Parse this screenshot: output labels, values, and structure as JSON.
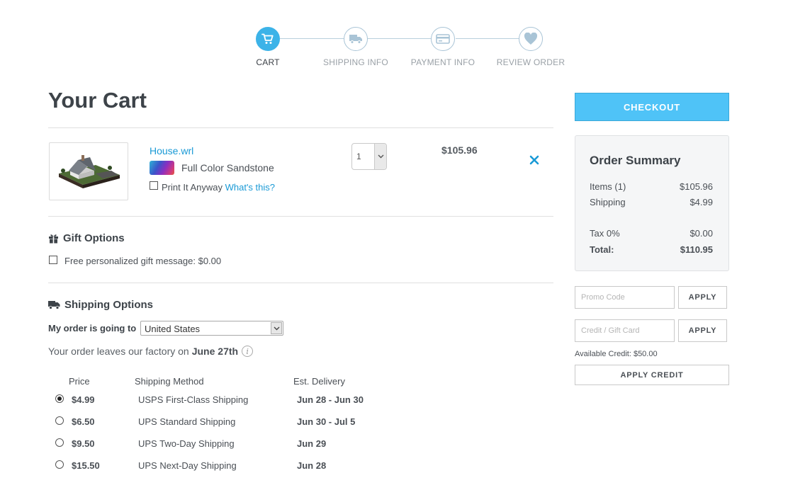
{
  "steps": [
    {
      "label": "CART",
      "icon": "cart-icon",
      "active": true
    },
    {
      "label": "SHIPPING INFO",
      "icon": "truck-icon",
      "active": false
    },
    {
      "label": "PAYMENT INFO",
      "icon": "credit-card-icon",
      "active": false
    },
    {
      "label": "REVIEW ORDER",
      "icon": "heart-icon",
      "active": false
    }
  ],
  "page": {
    "title": "Your Cart"
  },
  "cart_item": {
    "name": "House.wrl",
    "material": "Full Color Sandstone",
    "print_anyway_label": "Print It Anyway",
    "whats_this": "What's this?",
    "quantity": "1",
    "price": "$105.96"
  },
  "gift": {
    "title": "Gift Options",
    "message_label": "Free personalized gift message: $0.00"
  },
  "shipping": {
    "title": "Shipping Options",
    "going_to_label": "My order is going to",
    "country": "United States",
    "leaves_text": "Your order leaves our factory on",
    "leaves_date": "June 27th",
    "headers": {
      "price": "Price",
      "method": "Shipping Method",
      "delivery": "Est. Delivery"
    },
    "options": [
      {
        "price": "$4.99",
        "method": "USPS First-Class Shipping",
        "delivery": "Jun 28 - Jun 30",
        "selected": true
      },
      {
        "price": "$6.50",
        "method": "UPS Standard Shipping",
        "delivery": "Jun 30 - Jul 5",
        "selected": false
      },
      {
        "price": "$9.50",
        "method": "UPS Two-Day Shipping",
        "delivery": "Jun 29",
        "selected": false
      },
      {
        "price": "$15.50",
        "method": "UPS Next-Day Shipping",
        "delivery": "Jun 28",
        "selected": false
      }
    ]
  },
  "checkout_label": "CHECKOUT",
  "summary": {
    "title": "Order Summary",
    "items_label": "Items (1)",
    "items_value": "$105.96",
    "shipping_label": "Shipping",
    "shipping_value": "$4.99",
    "tax_label": "Tax 0%",
    "tax_value": "$0.00",
    "total_label": "Total:",
    "total_value": "$110.95"
  },
  "promo": {
    "placeholder": "Promo Code",
    "apply_label": "APPLY"
  },
  "gift_card": {
    "placeholder": "Credit / Gift Card",
    "apply_label": "APPLY"
  },
  "available_credit": "Available Credit: $50.00",
  "apply_credit_label": "APPLY CREDIT",
  "colors": {
    "accent": "#4fc3f7",
    "link": "#1a9ad6"
  }
}
